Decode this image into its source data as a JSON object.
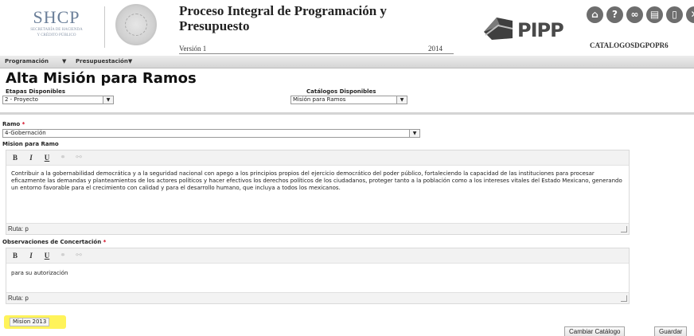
{
  "header": {
    "org_name": "SHCP",
    "org_subtitle_1": "SECRETARÍA DE HACIENDA",
    "org_subtitle_2": "Y CRÉDITO PÚBLICO",
    "title_line_1": "Proceso Integral de Programación y",
    "title_line_2": "Presupuesto",
    "version": "Versión 1",
    "year": "2014",
    "app_logo": "PIPP",
    "user": "CATALOGOSDGPOPR6",
    "icons": [
      "home-icon",
      "help-icon",
      "link-icon",
      "calendar-icon",
      "book-icon",
      "close-icon"
    ]
  },
  "menu": {
    "items": [
      "Programación",
      "Presupuestación"
    ]
  },
  "page": {
    "title": "Alta Misión para Ramos",
    "etapas_label": "Etapas Disponibles",
    "etapas_value": "2 - Proyecto",
    "catalogos_label": "Catálogos Disponibles",
    "catalogos_value": "Misión para Ramos",
    "ramo_label": "Ramo",
    "ramo_required": "*",
    "ramo_value": "4-Gobernación",
    "mision_label": "Mision para Ramo",
    "mision_text": "Contribuir a la gobernabilidad democrática y a la seguridad nacional con apego a los principios propios del ejercicio democrático del poder público, fortaleciendo la capacidad de las instituciones para procesar eficazmente las demandas y planteamientos de los actores políticos y hacer efectivos los derechos políticos de los ciudadanos, proteger tanto a la población como a los intereses vitales del Estado Mexicano, generando un entorno favorable para el crecimiento con calidad y para el desarrollo humano, que incluya a todos los mexicanos.",
    "mision_path": "Ruta: p",
    "obs_label": "Observaciones de Concertación",
    "obs_required": "*",
    "obs_text": "para su autorización",
    "obs_path": "Ruta: p",
    "mision_tag": "Mision 2013"
  },
  "toolbar": {
    "bold": "B",
    "italic": "I",
    "underline": "U"
  },
  "buttons": {
    "cambiar": "Cambiar Catálogo",
    "guardar": "Guardar"
  },
  "colors": {
    "highlight": "#fff35a",
    "required": "#d0021b"
  }
}
